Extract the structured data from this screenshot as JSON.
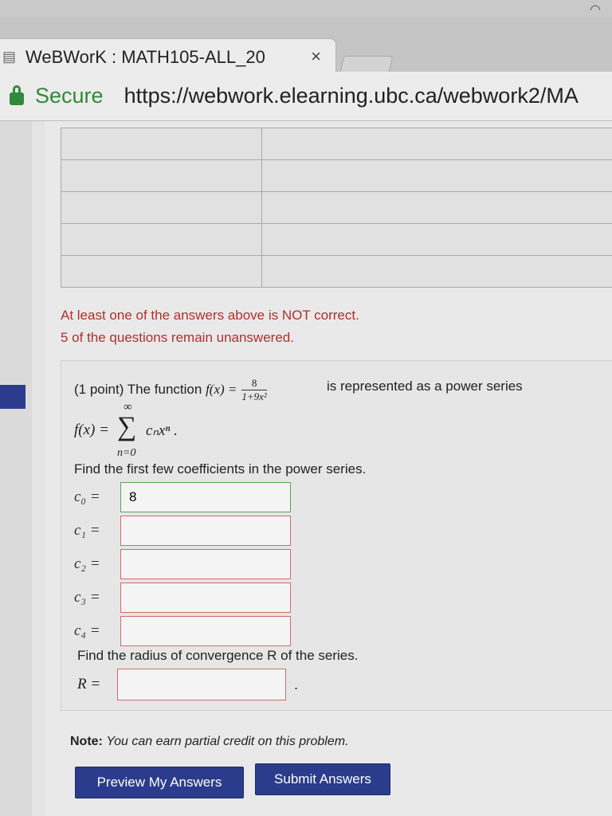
{
  "browser": {
    "tab_title": "WeBWorK : MATH105-ALL_20",
    "tab_close": "×",
    "secure_label": "Secure",
    "url": "https://webwork.elearning.ubc.ca/webwork2/MA"
  },
  "results": {
    "rows": 5,
    "cols": 2
  },
  "messages": {
    "incorrect": "At least one of the answers above is NOT correct.",
    "unanswered": "5 of the questions remain unanswered."
  },
  "problem": {
    "intro_prefix": "(1 point) The function ",
    "fx": "f(x) =",
    "frac_num": "8",
    "frac_den": "1+9x²",
    "intro_suffix": "is represented as a power series",
    "series_lhs": "f(x) =",
    "sigma": "∑",
    "sigma_top": "∞",
    "sigma_bottom": "n=0",
    "series_term": "cₙxⁿ .",
    "find_coefficients": "Find the first few coefficients in the power series.",
    "coefficients": [
      {
        "label": "c₀ =",
        "value": "8"
      },
      {
        "label": "c₁ =",
        "value": ""
      },
      {
        "label": "c₂ =",
        "value": ""
      },
      {
        "label": "c₃ =",
        "value": ""
      },
      {
        "label": "c₄ =",
        "value": ""
      }
    ],
    "find_radius": "Find the radius of convergence R of the series.",
    "radius_label": "R =",
    "radius_value": "",
    "radius_dot": "."
  },
  "note": {
    "label": "Note:",
    "text": "You can earn partial credit on this problem."
  },
  "buttons": {
    "preview": "Preview My Answers",
    "submit": "Submit Answers"
  },
  "colors": {
    "secure_green": "#2f8a3b",
    "error_red": "#b0302a",
    "button_blue": "#2b3c8c"
  }
}
